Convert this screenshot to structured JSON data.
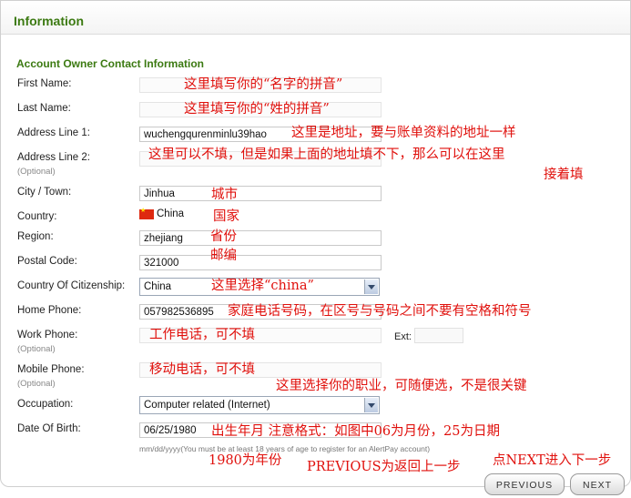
{
  "header": {
    "title": "Information"
  },
  "section": {
    "title": "Account Owner Contact Information"
  },
  "optional_label": "(Optional)",
  "fields": {
    "first_name": {
      "label": "First Name:",
      "value": ""
    },
    "last_name": {
      "label": "Last Name:",
      "value": ""
    },
    "address1": {
      "label": "Address Line 1:",
      "value": "wuchengqurenminlu39hao"
    },
    "address2": {
      "label": "Address Line 2:",
      "value": ""
    },
    "city": {
      "label": "City / Town:",
      "value": "Jinhua"
    },
    "country": {
      "label": "Country:",
      "value": "China",
      "flag": "china-flag-icon"
    },
    "region": {
      "label": "Region:",
      "value": "zhejiang"
    },
    "postal": {
      "label": "Postal Code:",
      "value": "321000"
    },
    "citizenship": {
      "label": "Country Of Citizenship:",
      "value": "China"
    },
    "home_phone": {
      "label": "Home Phone:",
      "value": "057982536895"
    },
    "work_phone": {
      "label": "Work Phone:",
      "value": "",
      "ext_label": "Ext:"
    },
    "mobile_phone": {
      "label": "Mobile Phone:",
      "value": ""
    },
    "occupation": {
      "label": "Occupation:",
      "value": "Computer related (Internet)"
    },
    "dob": {
      "label": "Date Of Birth:",
      "value": "06/25/1980",
      "hint": "mm/dd/yyyy(You must be at least 18 years of age to register for an AlertPay account)"
    }
  },
  "annotations": {
    "first_name": "这里填写你的“名字的拼音”",
    "last_name": "这里填写你的“姓的拼音”",
    "address1": "这里是地址，要与账单资料的地址一样",
    "address2_line1": "这里可以不填，但是如果上面的地址填不下，那么可以在这里",
    "address2_line2": "接着填",
    "city": "城市",
    "country": "国家",
    "region": "省份",
    "postal": "邮编",
    "citizenship": "这里选择“china”",
    "home_phone": "家庭电话号码，在区号与号码之间不要有空格和符号",
    "work_phone": "工作电话，可不填",
    "mobile_phone": "移动电话，可不填",
    "occupation": "这里选择你的职业，可随便选，不是很关键",
    "dob": "出生年月 注意格式：如图中06为月份，25为日期",
    "dob_year": "1980为年份",
    "previous": "PREVIOUS为返回上一步",
    "next": "点NEXT进入下一步"
  },
  "buttons": {
    "previous": "PREVIOUS",
    "next": "NEXT"
  },
  "colors": {
    "accent_green": "#3c7a12",
    "annotation_red": "#e0100c"
  }
}
